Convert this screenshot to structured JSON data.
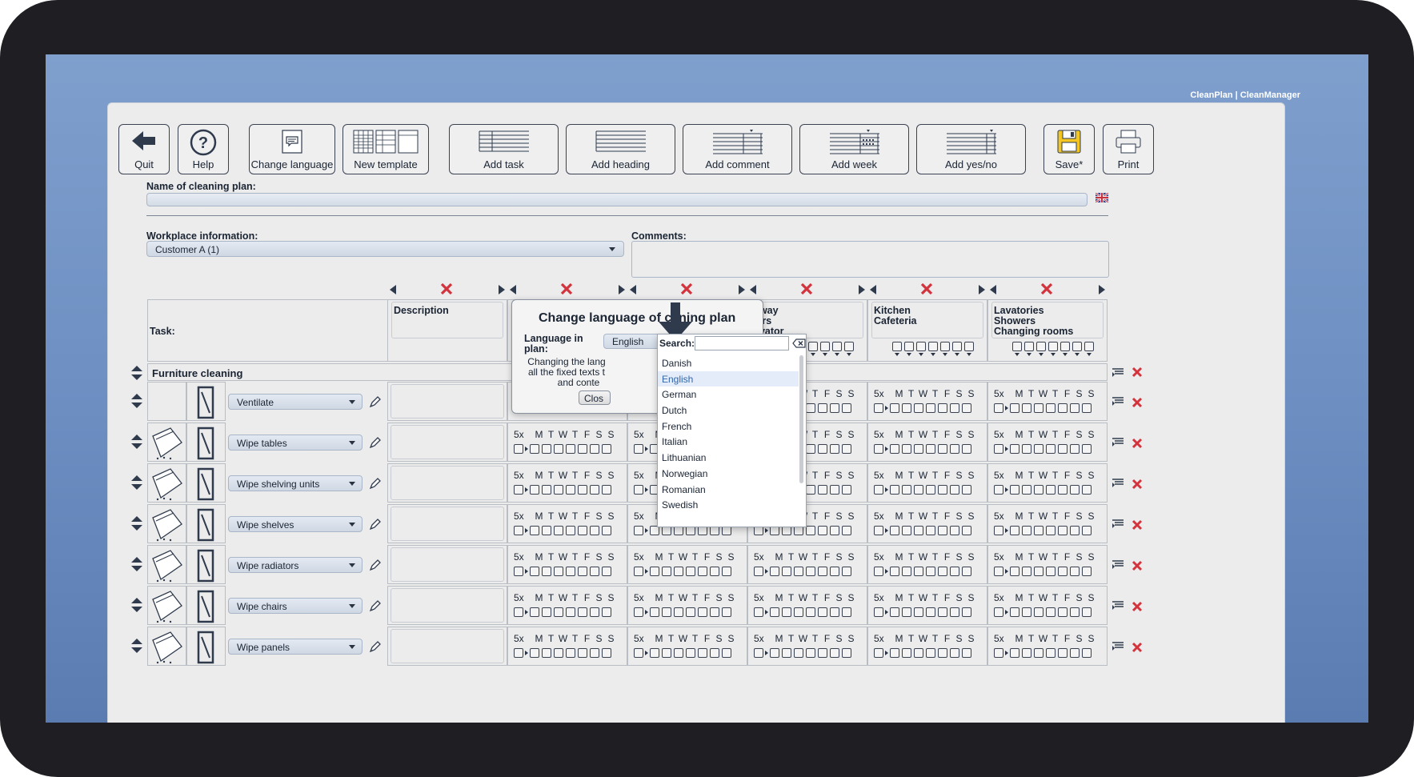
{
  "brand": "CleanPlan | CleanManager",
  "toolbar": {
    "quit": "Quit",
    "help": "Help",
    "change_language": "Change language",
    "new_template": "New template",
    "add_task": "Add task",
    "add_heading": "Add heading",
    "add_comment": "Add comment",
    "add_week": "Add week",
    "add_yesno": "Add yes/no",
    "save": "Save*",
    "print": "Print"
  },
  "form": {
    "name_label": "Name of cleaning plan:",
    "workplace_label": "Workplace information:",
    "workplace_value": "Customer A (1)",
    "comments_label": "Comments:"
  },
  "grid": {
    "task_header": "Task:",
    "columns": [
      {
        "lines": [
          "Description"
        ]
      },
      {
        "lines": [
          ""
        ]
      },
      {
        "lines": [
          ""
        ]
      },
      {
        "lines": [
          "llway",
          "airs",
          "evator"
        ]
      },
      {
        "lines": [
          "Kitchen",
          "Cafeteria"
        ]
      },
      {
        "lines": [
          "Lavatories",
          "Showers",
          "Changing rooms"
        ]
      }
    ],
    "section": "Furniture cleaning",
    "freq": "5x",
    "days": [
      "M",
      "T",
      "W",
      "T",
      "F",
      "S",
      "S"
    ],
    "rows": [
      {
        "task": "Ventilate"
      },
      {
        "task": "Wipe tables"
      },
      {
        "task": "Wipe shelving units"
      },
      {
        "task": "Wipe shelves"
      },
      {
        "task": "Wipe radiators"
      },
      {
        "task": "Wipe chairs"
      },
      {
        "task": "Wipe panels"
      }
    ]
  },
  "dialog": {
    "title": "Change language of cl  ning plan",
    "lang_label_1": "Language in",
    "lang_label_2": "plan:",
    "selected": "English",
    "desc_1": "Changing the lang",
    "desc_2": "all the fixed texts t",
    "desc_3": "and conte",
    "close_btn": "Clos"
  },
  "dropdown": {
    "search_label": "Search:",
    "search_value": "",
    "options": [
      "Danish",
      "English",
      "German",
      "Dutch",
      "French",
      "Italian",
      "Lithuanian",
      "Norwegian",
      "Romanian",
      "Swedish"
    ],
    "selected_index": 1
  },
  "colors": {
    "accent_red": "#d3333d",
    "dark_icon": "#2f3b4d",
    "save_yellow": "#f3c624"
  }
}
